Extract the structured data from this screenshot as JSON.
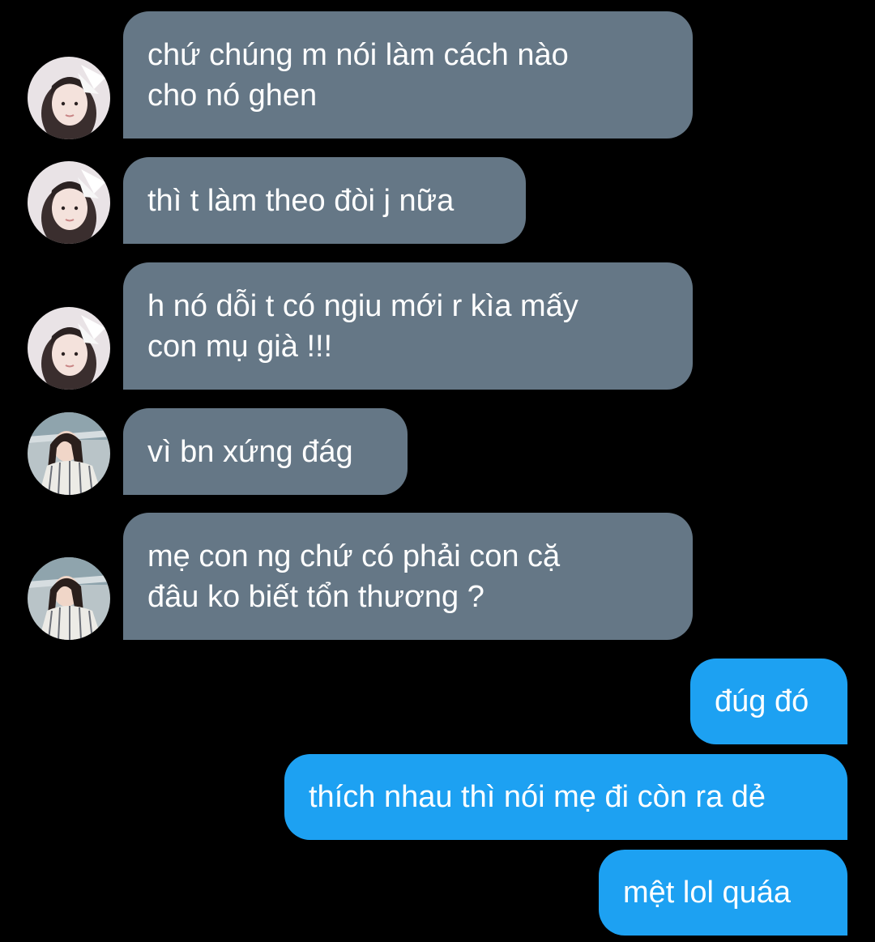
{
  "colors": {
    "background": "#000000",
    "incoming_bubble": "#657786",
    "outgoing_bubble": "#1da1f2",
    "text": "#ffffff"
  },
  "messages": [
    {
      "direction": "incoming",
      "avatar": "avatar-girl-white-bow",
      "text": "chứ chúng m nói làm cách nào\ncho nó ghen"
    },
    {
      "direction": "incoming",
      "avatar": "avatar-girl-white-bow",
      "text": "thì t làm theo đòi j nữa"
    },
    {
      "direction": "incoming",
      "avatar": "avatar-girl-white-bow",
      "text": "h nó dỗi t có ngiu mới r kìa mấy\ncon mụ già !!!"
    },
    {
      "direction": "incoming",
      "avatar": "avatar-girl-striped-shirt",
      "text": "vì bn xứng đág"
    },
    {
      "direction": "incoming",
      "avatar": "avatar-girl-striped-shirt",
      "text": "mẹ con ng chứ có phải con cặ\nđâu ko biết tổn thương ?"
    },
    {
      "direction": "outgoing",
      "text": "đúg đó"
    },
    {
      "direction": "outgoing",
      "text": "thích nhau thì nói mẹ đi còn ra dẻ"
    },
    {
      "direction": "outgoing",
      "text": "mệt lol quáa"
    }
  ]
}
